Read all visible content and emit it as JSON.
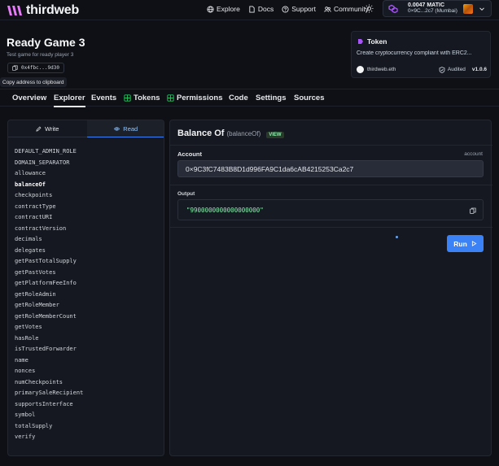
{
  "nav": {
    "brand": "thirdweb",
    "links": [
      {
        "label": "Explore",
        "icon": "globe-icon"
      },
      {
        "label": "Docs",
        "icon": "document-icon"
      },
      {
        "label": "Support",
        "icon": "help-circle-icon"
      },
      {
        "label": "Community",
        "icon": "users-icon"
      }
    ],
    "wallet": {
      "balance": "0.0047 MATIC",
      "address": "0×9C...2c7 (Mumbai)"
    }
  },
  "contract": {
    "title": "Ready Game 3",
    "description": "Test game for ready player 3",
    "address_short": "0x4fbc...9d30",
    "copy_tooltip": "Copy address to clipboard"
  },
  "token_card": {
    "title": "Token",
    "description": "Create cryptocurrency compliant with ERC2...",
    "publisher": "thirdweb.eth",
    "audited": "Audited",
    "version": "v1.0.6"
  },
  "tabs": [
    {
      "label": "Overview"
    },
    {
      "label": "Explorer"
    },
    {
      "label": "Events"
    },
    {
      "label": "Tokens"
    },
    {
      "label": "Permissions"
    },
    {
      "label": "Code"
    },
    {
      "label": "Settings"
    },
    {
      "label": "Sources"
    }
  ],
  "explorer": {
    "write_label": "Write",
    "read_label": "Read",
    "functions": [
      "DEFAULT_ADMIN_ROLE",
      "DOMAIN_SEPARATOR",
      "allowance",
      "balanceOf",
      "checkpoints",
      "contractType",
      "contractURI",
      "contractVersion",
      "decimals",
      "delegates",
      "getPastTotalSupply",
      "getPastVotes",
      "getPlatformFeeInfo",
      "getRoleAdmin",
      "getRoleMember",
      "getRoleMemberCount",
      "getVotes",
      "hasRole",
      "isTrustedForwarder",
      "name",
      "nonces",
      "numCheckpoints",
      "primarySaleRecipient",
      "supportsInterface",
      "symbol",
      "totalSupply",
      "verify"
    ],
    "selected_index": 3
  },
  "function_panel": {
    "name": "Balance Of",
    "signature": "(balanceOf)",
    "badge": "VIEW",
    "param_label": "Account",
    "param_type": "account",
    "param_value": "0×9C3fC7483B8D1d996FA9C1da6cAB4215253Ca2c7",
    "output_label": "Output",
    "output_value": "\"9900000000000000000\"",
    "run_label": "Run"
  },
  "colors": {
    "background": "#0e1016",
    "panel": "#151820",
    "accent": "#3b82f6",
    "output_text": "#86efac"
  }
}
